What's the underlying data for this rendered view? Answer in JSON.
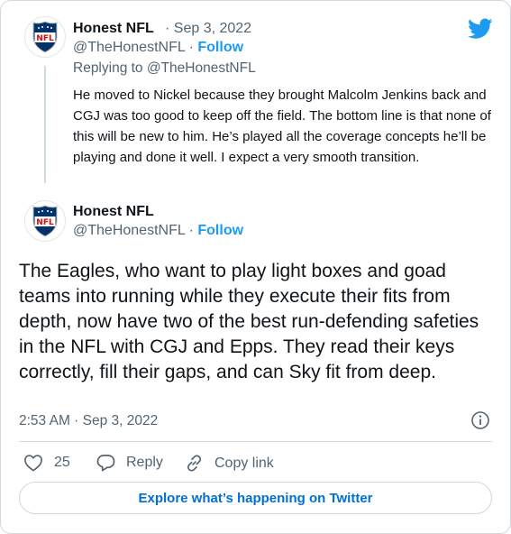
{
  "reply_tweet": {
    "author_name": "Honest NFL",
    "date": "· Sep 3, 2022",
    "handle": "@TheHonestNFL",
    "follow_separator": "·",
    "follow_label": "Follow",
    "replying_to_prefix": "Replying to",
    "replying_to_handle": "@TheHonestNFL",
    "text": "He moved to Nickel because they brought Malcolm Jenkins back and CGJ was too good to keep off the field. The bottom line is that none of this will be new to him. He’s played all the coverage concepts he’ll be playing and done it well. I expect a very smooth transition."
  },
  "main_tweet": {
    "author_name": "Honest NFL",
    "handle": "@TheHonestNFL",
    "follow_separator": "·",
    "follow_label": "Follow",
    "text": "The Eagles, who want to play light boxes and goad teams into running while they execute their fits from depth, now have two of the best run-defending safeties in the NFL with CGJ and Epps. They read their keys correctly, fill their gaps, and can Sky fit from deep.",
    "timestamp": "2:53 AM · Sep 3, 2022"
  },
  "actions": {
    "like_count": "25",
    "reply_label": "Reply",
    "copy_link_label": "Copy link"
  },
  "explore_label": "Explore what’s happening on Twitter",
  "icons": {
    "brand": "twitter-bird-icon",
    "avatar": "nfl-shield-logo",
    "info": "info-icon",
    "like": "heart-icon",
    "reply": "speech-bubble-icon",
    "copy_link": "link-icon"
  },
  "colors": {
    "accent": "#1d9bf0",
    "explore_text": "#006fd6",
    "secondary_text": "#536471",
    "border": "#cfd9de",
    "nfl_blue": "#013369",
    "nfl_red": "#d50a0a"
  }
}
